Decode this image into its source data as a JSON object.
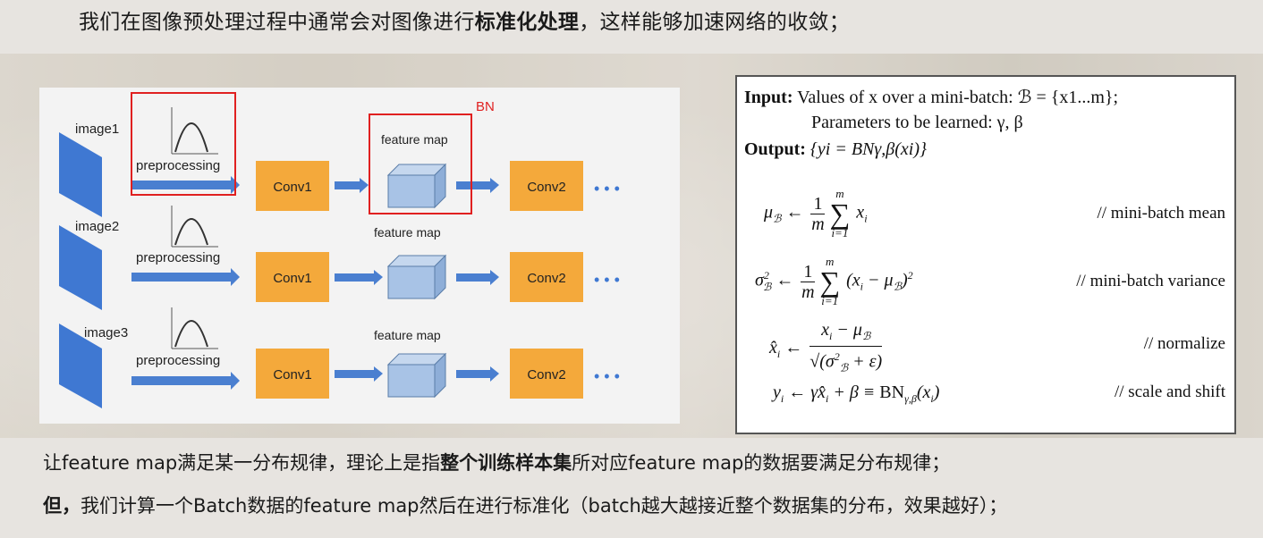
{
  "headline": {
    "prefix": "我们在图像预处理过程中通常会对图像进行",
    "bold": "标准化处理",
    "suffix": "，这样能够加速网络的收敛；"
  },
  "diagram": {
    "rows": [
      {
        "image_label": "image1",
        "prep_label": "preprocessing",
        "conv1": "Conv1",
        "fmap_label": "feature map",
        "conv2": "Conv2",
        "dots": "• • •"
      },
      {
        "image_label": "image2",
        "prep_label": "preprocessing",
        "conv1": "Conv1",
        "fmap_label": "feature map",
        "conv2": "Conv2",
        "dots": "• • •"
      },
      {
        "image_label": "image3",
        "prep_label": "preprocessing",
        "conv1": "Conv1",
        "fmap_label": "feature map",
        "conv2": "Conv2",
        "dots": "• • •"
      }
    ],
    "bn_label": "BN",
    "colors": {
      "conv": "#f4a93b",
      "arrow": "#4a7fd0",
      "image": "#3f78d2",
      "cube": "#a8c3e6",
      "highlight": "#e02020"
    }
  },
  "algorithm": {
    "input_label": "Input:",
    "input_text": "Values of x over a mini-batch: ℬ = {x1...m};",
    "params_text": "Parameters to be learned: γ, β",
    "output_label": "Output:",
    "output_text": "{yi = BNγ,β(xi)}",
    "comments": [
      "// mini-batch mean",
      "// mini-batch variance",
      "// normalize",
      "// scale and shift"
    ]
  },
  "line2": {
    "prefix": "让feature map满足某一分布规律，理论上是指",
    "bold": "整个训练样本集",
    "suffix": "所对应feature map的数据要满足分布规律；"
  },
  "line3": {
    "bold": "但，",
    "text": "我们计算一个Batch数据的feature map然后在进行标准化（batch越大越接近整个数据集的分布，效果越好）；"
  }
}
